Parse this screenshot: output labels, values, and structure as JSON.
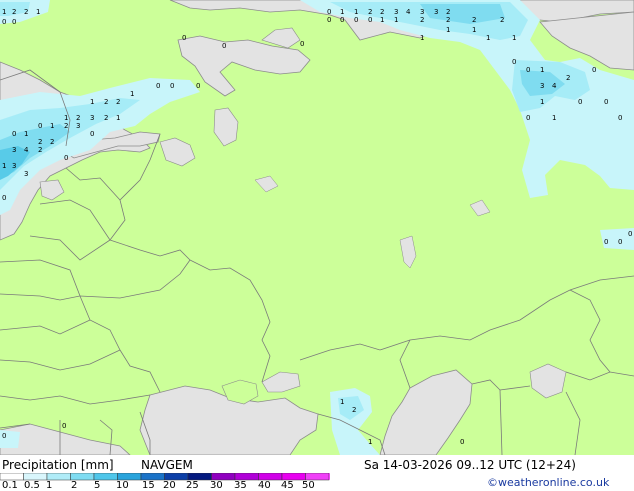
{
  "map": {
    "land_color": "#ccff99",
    "sea_color": "#e3e3e3",
    "precip_colors": [
      "#c8f5fa",
      "#a6ecf7",
      "#7fdcf0",
      "#58cbe8"
    ],
    "border_color": "#7a7a7a",
    "coast_color": "#8c8c8c",
    "labels": [
      {
        "t": "1"
      },
      {
        "t": "2"
      },
      {
        "t": "2"
      },
      {
        "t": "1"
      },
      {
        "t": "0"
      },
      {
        "t": "0"
      },
      {
        "t": "0"
      },
      {
        "t": "0"
      },
      {
        "t": "0"
      },
      {
        "t": "0"
      },
      {
        "t": "0"
      },
      {
        "t": "0"
      },
      {
        "t": "0"
      },
      {
        "t": "0"
      },
      {
        "t": "1"
      },
      {
        "t": "1"
      },
      {
        "t": "2"
      },
      {
        "t": "2"
      },
      {
        "t": "3"
      },
      {
        "t": "4"
      },
      {
        "t": "3"
      },
      {
        "t": "3"
      },
      {
        "t": "2"
      },
      {
        "t": "1"
      },
      {
        "t": "1"
      },
      {
        "t": "2"
      },
      {
        "t": "2"
      },
      {
        "t": "2"
      },
      {
        "t": "2"
      },
      {
        "t": "1"
      },
      {
        "t": "1"
      },
      {
        "t": "1"
      },
      {
        "t": "1"
      },
      {
        "t": "1"
      },
      {
        "t": "0"
      },
      {
        "t": "0"
      },
      {
        "t": "1"
      },
      {
        "t": "3"
      },
      {
        "t": "4"
      },
      {
        "t": "2"
      },
      {
        "t": "0"
      },
      {
        "t": "1"
      },
      {
        "t": "1"
      },
      {
        "t": "0"
      },
      {
        "t": "0"
      },
      {
        "t": "0"
      },
      {
        "t": "0"
      },
      {
        "t": "1"
      },
      {
        "t": "2"
      },
      {
        "t": "2"
      },
      {
        "t": "1"
      },
      {
        "t": "1"
      },
      {
        "t": "2"
      },
      {
        "t": "3"
      },
      {
        "t": "2"
      },
      {
        "t": "1"
      },
      {
        "t": "0"
      },
      {
        "t": "1"
      },
      {
        "t": "2"
      },
      {
        "t": "3"
      },
      {
        "t": "0"
      },
      {
        "t": "0"
      },
      {
        "t": "1"
      },
      {
        "t": "2"
      },
      {
        "t": "2"
      },
      {
        "t": "3"
      },
      {
        "t": "4"
      },
      {
        "t": "2"
      },
      {
        "t": "0"
      },
      {
        "t": "1"
      },
      {
        "t": "3"
      },
      {
        "t": "3"
      },
      {
        "t": "0"
      },
      {
        "t": "0"
      },
      {
        "t": "0"
      },
      {
        "t": "0"
      },
      {
        "t": "0"
      },
      {
        "t": "0"
      },
      {
        "t": "0"
      },
      {
        "t": "1"
      },
      {
        "t": "2"
      },
      {
        "t": "1"
      },
      {
        "t": "0"
      },
      {
        "t": "0"
      },
      {
        "t": "0"
      }
    ]
  },
  "legend": {
    "title": "Precipitation [mm]",
    "model": "NAVGEM",
    "valid": "Sa 14-03-2026 09..12 UTC (12+24)",
    "credit": "©weatheronline.co.uk",
    "tick_labels": [
      "0.1",
      "0.5",
      "1",
      "2",
      "5",
      "10",
      "15",
      "20",
      "25",
      "30",
      "35",
      "40",
      "45",
      "50"
    ],
    "colors": [
      "#ffffff",
      "#d9f6fc",
      "#b0ecf8",
      "#7fdcf2",
      "#4fc6ea",
      "#2aa4dc",
      "#1a73c8",
      "#0c3fa8",
      "#051a80",
      "#9000c0",
      "#b000d8",
      "#d000e8",
      "#e800f0",
      "#f040f8"
    ]
  }
}
